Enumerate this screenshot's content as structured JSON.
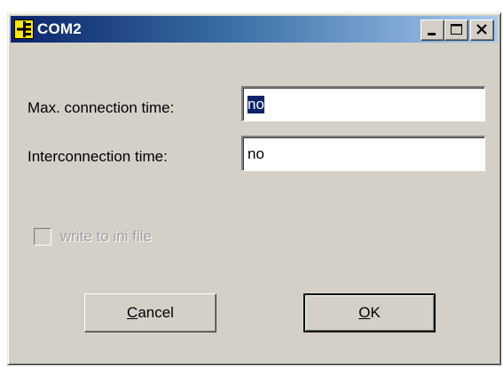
{
  "window": {
    "title": "COM2",
    "icon": "com-port-icon",
    "title_buttons": [
      "minimize-icon",
      "maximize-icon",
      "close-icon"
    ]
  },
  "form": {
    "max_connection_time": {
      "label": "Max. connection time:",
      "value": "no"
    },
    "interconnection_time": {
      "label": "Interconnection time:",
      "value": "no"
    },
    "write_to_ini": {
      "label": "write to ini file",
      "checked": false,
      "enabled": false
    }
  },
  "buttons": {
    "cancel": {
      "accel": "C",
      "rest": "ancel"
    },
    "ok": {
      "accel": "O",
      "rest": "K"
    }
  },
  "colors": {
    "titlebar_start": "#0a246a",
    "titlebar_end": "#a6caf0",
    "face": "#d4d0c8",
    "selection": "#0a246a"
  }
}
